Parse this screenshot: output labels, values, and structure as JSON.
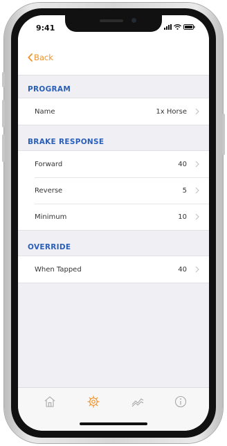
{
  "status_bar": {
    "time": "9:41"
  },
  "nav": {
    "back_label": "Back"
  },
  "sections": [
    {
      "title": "PROGRAM",
      "rows": [
        {
          "label": "Name",
          "value": "1x Horse"
        }
      ]
    },
    {
      "title": "BRAKE RESPONSE",
      "rows": [
        {
          "label": "Forward",
          "value": "40"
        },
        {
          "label": "Reverse",
          "value": "5"
        },
        {
          "label": "Minimum",
          "value": "10"
        }
      ]
    },
    {
      "title": "OVERRIDE",
      "rows": [
        {
          "label": "When Tapped",
          "value": "40"
        }
      ]
    }
  ],
  "tab_bar": {
    "tabs": [
      {
        "icon": "home-icon",
        "active": false
      },
      {
        "icon": "gear-icon",
        "active": true
      },
      {
        "icon": "graph-icon",
        "active": false
      },
      {
        "icon": "info-icon",
        "active": false
      }
    ]
  },
  "colors": {
    "accent": "#f0932b",
    "section_header": "#2a5fb8",
    "background": "#efeff4",
    "inactive_icon": "#a8a8a8"
  }
}
